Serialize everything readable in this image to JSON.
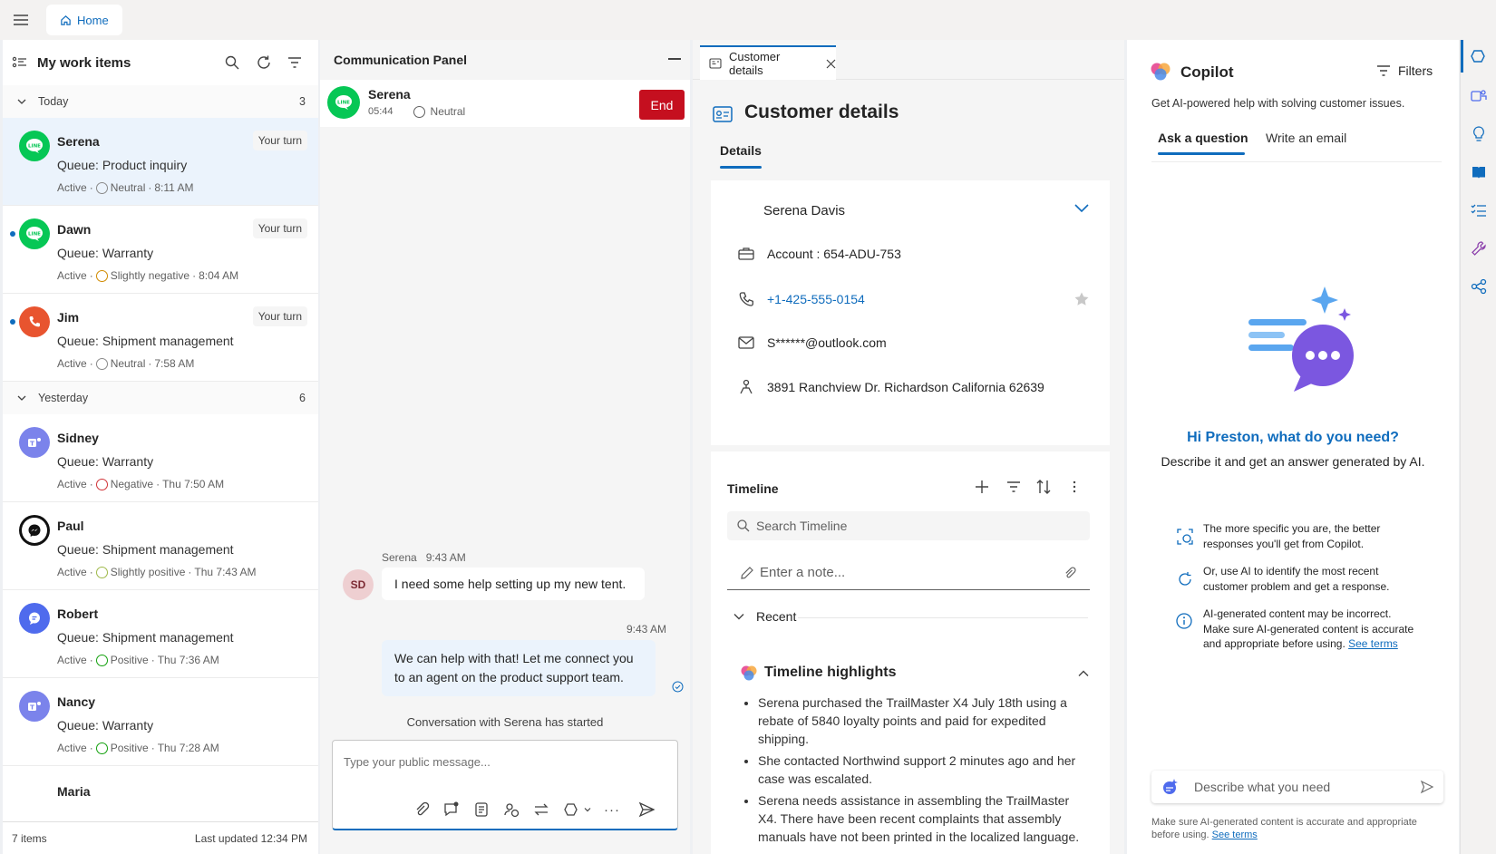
{
  "topbar": {
    "home_tab": "Home"
  },
  "work_items": {
    "title": "My work items",
    "groups": [
      {
        "label": "Today",
        "count": "3"
      },
      {
        "label": "Yesterday",
        "count": "6"
      }
    ],
    "items": [
      {
        "name": "Serena",
        "queue": "Queue: Product inquiry",
        "status": "Active",
        "sentiment": "Neutral",
        "time": "8:11 AM",
        "turn": "Your turn",
        "channel": "line"
      },
      {
        "name": "Dawn",
        "queue": "Queue: Warranty",
        "status": "Active",
        "sentiment": "Slightly negative",
        "time": "8:04 AM",
        "turn": "Your turn",
        "channel": "line"
      },
      {
        "name": "Jim",
        "queue": "Queue: Shipment management",
        "status": "Active",
        "sentiment": "Neutral",
        "time": "7:58 AM",
        "turn": "Your turn",
        "channel": "phone"
      },
      {
        "name": "Sidney",
        "queue": "Queue: Warranty",
        "status": "Active",
        "sentiment": "Negative",
        "time": "Thu 7:50 AM",
        "channel": "teams"
      },
      {
        "name": "Paul",
        "queue": "Queue: Shipment management",
        "status": "Active",
        "sentiment": "Slightly positive",
        "time": "Thu 7:43 AM",
        "channel": "messenger"
      },
      {
        "name": "Robert",
        "queue": "Queue: Shipment management",
        "status": "Active",
        "sentiment": "Positive",
        "time": "Thu 7:36 AM",
        "channel": "chat"
      },
      {
        "name": "Nancy",
        "queue": "Queue: Warranty",
        "status": "Active",
        "sentiment": "Positive",
        "time": "Thu 7:28 AM",
        "channel": "teams"
      },
      {
        "name": "Maria"
      }
    ],
    "footer_count": "7 items",
    "footer_updated": "Last updated 12:34 PM"
  },
  "comm": {
    "title": "Communication Panel",
    "contact_name": "Serena",
    "timer": "05:44",
    "sentiment": "Neutral",
    "end_label": "End",
    "msg1_sender": "Serena",
    "msg1_time": "9:43 AM",
    "msg1_initials": "SD",
    "msg1_text": "I need some help setting up my new tent.",
    "msg2_time": "9:43 AM",
    "msg2_text": "We can help with that! Let me connect you to an agent on the product support team.",
    "system_msg": "Conversation with Serena has started",
    "compose_placeholder": "Type your public message..."
  },
  "customer": {
    "tab_label": "Customer details",
    "title": "Customer details",
    "subtab": "Details",
    "name": "Serena Davis",
    "account": "Account : 654-ADU-753",
    "phone": "+1-425-555-0154",
    "email": "S******@outlook.com",
    "address": "3891 Ranchview Dr. Richardson California 62639"
  },
  "timeline": {
    "title": "Timeline",
    "search_placeholder": "Search Timeline",
    "note_placeholder": "Enter a note...",
    "recent_label": "Recent",
    "highlights_title": "Timeline highlights",
    "bullets": [
      "Serena purchased the TrailMaster X4 July 18th using a rebate of 5840 loyalty points and paid for expedited shipping.",
      "She contacted Northwind support 2 minutes ago and her case was escalated.",
      "Serena needs assistance in assembling the TrailMaster X4. There have been recent complaints that assembly manuals have not been printed in the localized language."
    ]
  },
  "copilot": {
    "title": "Copilot",
    "filters_label": "Filters",
    "subtitle": "Get AI-powered help with solving customer issues.",
    "tab_ask": "Ask a question",
    "tab_email": "Write an email",
    "greeting": "Hi Preston, what do you need?",
    "greeting_sub": "Describe it and get an answer generated by AI.",
    "tip1": "The more specific you are, the better responses you'll get from Copilot.",
    "tip2": "Or, use AI to identify the most recent customer problem and get a response.",
    "tip3": "AI-generated content may be incorrect. Make sure AI-generated content is accurate and appropriate before using.",
    "tip3_link": "See terms",
    "input_placeholder": "Describe what you need",
    "disclaimer": "Make sure AI-generated content is accurate and appropriate before using.",
    "disclaimer_link": "See terms"
  },
  "colors": {
    "accent": "#0f6cbd",
    "danger": "#c50f1f",
    "line_green": "#06c755",
    "teams": "#5b5fc7"
  }
}
